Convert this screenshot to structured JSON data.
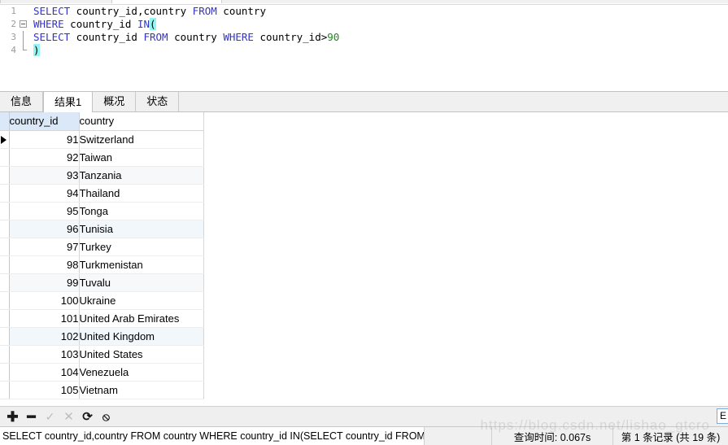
{
  "editor": {
    "lines": [
      {
        "number": "1",
        "fold": "none",
        "tokens": [
          {
            "t": "SELECT",
            "k": "kw"
          },
          {
            "t": " country_id,country ",
            "k": ""
          },
          {
            "t": "FROM",
            "k": "kw"
          },
          {
            "t": " country",
            "k": ""
          }
        ]
      },
      {
        "number": "2",
        "fold": "box",
        "tokens": [
          {
            "t": "WHERE",
            "k": "kw"
          },
          {
            "t": " country_id ",
            "k": ""
          },
          {
            "t": "IN",
            "k": "kw"
          },
          {
            "t": "(",
            "k": "brk"
          }
        ]
      },
      {
        "number": "3",
        "fold": "line",
        "tokens": [
          {
            "t": "SELECT",
            "k": "kw"
          },
          {
            "t": " country_id ",
            "k": ""
          },
          {
            "t": "FROM",
            "k": "kw"
          },
          {
            "t": " country ",
            "k": ""
          },
          {
            "t": "WHERE",
            "k": "kw"
          },
          {
            "t": " country_id>",
            "k": ""
          },
          {
            "t": "90",
            "k": "num"
          }
        ]
      },
      {
        "number": "4",
        "fold": "end",
        "tokens": [
          {
            "t": ")",
            "k": "brk"
          }
        ]
      }
    ]
  },
  "tabs": [
    {
      "label": "信息",
      "name": "tab-info",
      "active": false
    },
    {
      "label": "结果1",
      "name": "tab-result1",
      "active": true
    },
    {
      "label": "概况",
      "name": "tab-profile",
      "active": false
    },
    {
      "label": "状态",
      "name": "tab-status",
      "active": false
    }
  ],
  "grid": {
    "columns": [
      {
        "label": "country_id",
        "selected": true
      },
      {
        "label": "country",
        "selected": false
      }
    ],
    "current_row_index": 0,
    "rows": [
      {
        "country_id": "91",
        "country": "Switzerland",
        "shade": "plain"
      },
      {
        "country_id": "92",
        "country": "Taiwan",
        "shade": "plain"
      },
      {
        "country_id": "93",
        "country": "Tanzania",
        "shade": "grey"
      },
      {
        "country_id": "94",
        "country": "Thailand",
        "shade": "plain"
      },
      {
        "country_id": "95",
        "country": "Tonga",
        "shade": "plain"
      },
      {
        "country_id": "96",
        "country": "Tunisia",
        "shade": "blue"
      },
      {
        "country_id": "97",
        "country": "Turkey",
        "shade": "plain"
      },
      {
        "country_id": "98",
        "country": "Turkmenistan",
        "shade": "plain"
      },
      {
        "country_id": "99",
        "country": "Tuvalu",
        "shade": "grey"
      },
      {
        "country_id": "100",
        "country": "Ukraine",
        "shade": "plain"
      },
      {
        "country_id": "101",
        "country": "United Arab Emirates",
        "shade": "plain"
      },
      {
        "country_id": "102",
        "country": "United Kingdom",
        "shade": "blue"
      },
      {
        "country_id": "103",
        "country": "United States",
        "shade": "plain"
      },
      {
        "country_id": "104",
        "country": "Venezuela",
        "shade": "plain"
      },
      {
        "country_id": "105",
        "country": "Vietnam",
        "shade": "plain"
      }
    ]
  },
  "toolbar": {
    "buttons": [
      {
        "name": "add-record-button",
        "glyph": "✚",
        "cls": "plus",
        "disabled": false
      },
      {
        "name": "delete-record-button",
        "glyph": "━",
        "cls": "minus",
        "disabled": false
      },
      {
        "name": "apply-changes-button",
        "glyph": "✓",
        "cls": "check",
        "disabled": true
      },
      {
        "name": "cancel-changes-button",
        "glyph": "✕",
        "cls": "cross",
        "disabled": true
      },
      {
        "name": "refresh-button",
        "glyph": "⟳",
        "cls": "refresh",
        "disabled": false
      },
      {
        "name": "stop-button",
        "glyph": "⦸",
        "cls": "stop",
        "disabled": false
      }
    ],
    "right_field_value": "E"
  },
  "statusbar": {
    "sql": "SELECT country_id,country FROM country WHERE country_id IN(SELECT country_id FROM",
    "query_time": "查询时间: 0.067s",
    "record_count": "第 1 条记录 (共 19 条)"
  },
  "watermark": "https://blog.csdn.net/lishao_gtcro"
}
